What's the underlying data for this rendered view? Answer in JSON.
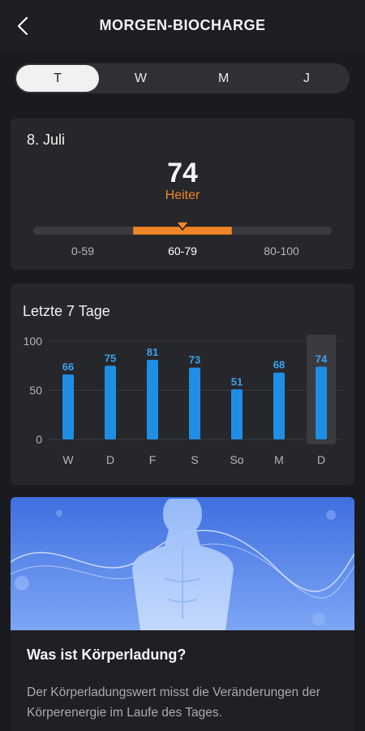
{
  "header": {
    "title": "MORGEN-BIOCHARGE"
  },
  "tabs": [
    {
      "label": "T",
      "active": true
    },
    {
      "label": "W",
      "active": false
    },
    {
      "label": "M",
      "active": false
    },
    {
      "label": "J",
      "active": false
    }
  ],
  "today": {
    "date": "8. Juli",
    "score": "74",
    "mood": "Heiter",
    "ranges": [
      "0-59",
      "60-79",
      "80-100"
    ],
    "active_range": 1
  },
  "week": {
    "title": "Letzte 7 Tage"
  },
  "chart_data": {
    "type": "bar",
    "categories": [
      "W",
      "D",
      "F",
      "S",
      "So",
      "M",
      "D"
    ],
    "values": [
      66,
      75,
      81,
      73,
      51,
      68,
      74
    ],
    "yticks": [
      "0",
      "50",
      "100"
    ],
    "ylim": [
      0,
      100
    ],
    "highlighted_index": 6,
    "bar_color": "#1f8fe6",
    "label_color": "#3aa3f0"
  },
  "info": {
    "title": "Was ist Körperladung?",
    "text": "Der Körperladungswert misst die Veränderungen der Körperenergie im Laufe des Tages."
  },
  "colors": {
    "accent_orange": "#f0862a",
    "accent_blue": "#1f8fe6",
    "background": "#1a1b1f",
    "card": "#26272b"
  }
}
